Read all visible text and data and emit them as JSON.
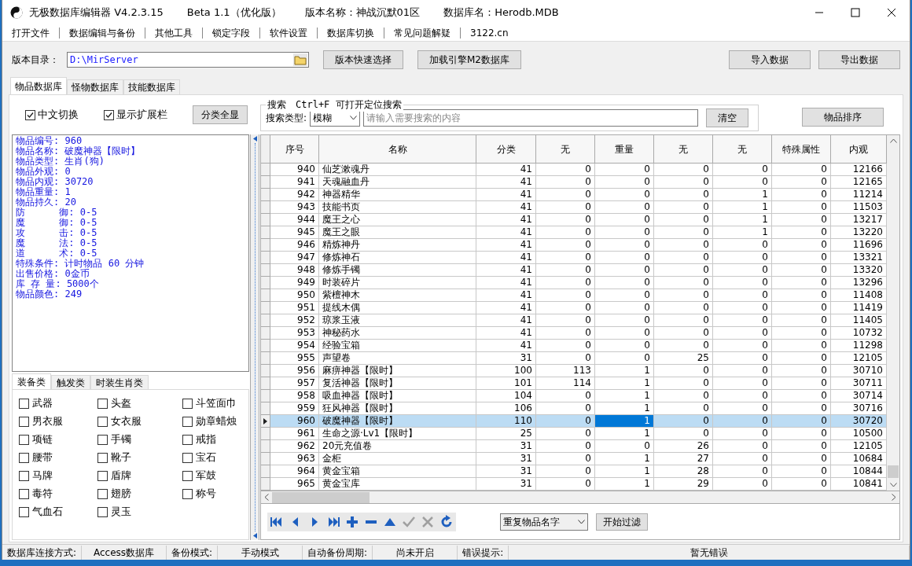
{
  "window": {
    "title_parts": [
      "无极数据库编辑器 V4.2.3.15",
      "Beta 1.1（优化版）",
      "版本名称：神战沉默01区",
      "数据库名：Herodb.MDB"
    ]
  },
  "menu": [
    "打开文件",
    "数据编辑与备份",
    "其他工具",
    "锁定字段",
    "软件设置",
    "数据库切换",
    "常见问题解疑",
    "3122.cn"
  ],
  "toolbar": {
    "dir_label": "版本目录：",
    "dir_value": "D:\\MirServer",
    "buttons": [
      "版本快速选择",
      "加载引擎M2数据库"
    ],
    "right_buttons": [
      "导入数据",
      "导出数据"
    ]
  },
  "tabs": [
    {
      "label": "物品数据库",
      "selected": true
    },
    {
      "label": "怪物数据库",
      "selected": false
    },
    {
      "label": "技能数据库",
      "selected": false
    }
  ],
  "options": [
    {
      "label": "中文切换",
      "checked": true
    },
    {
      "label": "显示扩展栏",
      "checked": true
    }
  ],
  "show_all_button": "分类全显",
  "search": {
    "title": "搜索　Ctrl+F 可打开定位搜索",
    "type_label": "搜索类型:",
    "type_value": "模糊",
    "placeholder": "请输入需要搜索的内容",
    "clear_button": "清空"
  },
  "sort_button": "物品排序",
  "info_lines": [
    "物品编号: 960",
    "物品名称: 破魔神器【限时】",
    "物品类型: 生肖(狗)",
    "物品外观: 0",
    "物品内观: 30720",
    "物品重量: 1",
    "物品持久: 20",
    "防      御: 0-5",
    "魔      御: 0-5",
    "攻      击: 0-5",
    "魔      法: 0-5",
    "道      术: 0-5",
    "特殊条件: 计时物品 60 分钟",
    "出售价格: 0金币",
    "库 存 量: 5000个",
    "物品颜色: 249"
  ],
  "sub_tabs": [
    {
      "label": "装备类",
      "selected": true
    },
    {
      "label": "触发类",
      "selected": false
    },
    {
      "label": "时装生肖类",
      "selected": false
    }
  ],
  "categories": [
    {
      "label": "武器",
      "checked": false
    },
    {
      "label": "头盔",
      "checked": false
    },
    {
      "label": "斗笠面巾",
      "checked": false
    },
    {
      "label": "男衣服",
      "checked": false
    },
    {
      "label": "女衣服",
      "checked": false
    },
    {
      "label": "勋章蜡烛",
      "checked": false
    },
    {
      "label": "项链",
      "checked": false
    },
    {
      "label": "手镯",
      "checked": false
    },
    {
      "label": "戒指",
      "checked": false
    },
    {
      "label": "腰带",
      "checked": false
    },
    {
      "label": "靴子",
      "checked": false
    },
    {
      "label": "宝石",
      "checked": false
    },
    {
      "label": "马牌",
      "checked": false
    },
    {
      "label": "盾牌",
      "checked": false
    },
    {
      "label": "军鼓",
      "checked": false
    },
    {
      "label": "毒符",
      "checked": false
    },
    {
      "label": "翅膀",
      "checked": false
    },
    {
      "label": "称号",
      "checked": false
    },
    {
      "label": "气血石",
      "checked": false
    },
    {
      "label": "灵玉",
      "checked": false
    }
  ],
  "table": {
    "columns": [
      {
        "label": "序号",
        "current": false
      },
      {
        "label": "名称",
        "current": false
      },
      {
        "label": "分类",
        "current": false
      },
      {
        "label": "无",
        "current": false
      },
      {
        "label": "重量",
        "current": true
      },
      {
        "label": "无",
        "current": false
      },
      {
        "label": "无",
        "current": false
      },
      {
        "label": "特殊属性",
        "current": false
      },
      {
        "label": "内观",
        "current": false
      }
    ],
    "rows": [
      {
        "cells": [
          "940",
          "仙芝漱魂丹",
          "41",
          "0",
          "0",
          "0",
          "0",
          "0",
          "12166"
        ],
        "selected": false
      },
      {
        "cells": [
          "941",
          "天魂融血丹",
          "41",
          "0",
          "0",
          "0",
          "0",
          "0",
          "12165"
        ],
        "selected": false
      },
      {
        "cells": [
          "942",
          "神器精华",
          "41",
          "0",
          "0",
          "0",
          "1",
          "0",
          "11214"
        ],
        "selected": false
      },
      {
        "cells": [
          "943",
          "技能书页",
          "41",
          "0",
          "0",
          "0",
          "1",
          "0",
          "11503"
        ],
        "selected": false
      },
      {
        "cells": [
          "944",
          "魔王之心",
          "41",
          "0",
          "0",
          "0",
          "1",
          "0",
          "13217"
        ],
        "selected": false
      },
      {
        "cells": [
          "945",
          "魔王之眼",
          "41",
          "0",
          "0",
          "0",
          "1",
          "0",
          "13220"
        ],
        "selected": false
      },
      {
        "cells": [
          "946",
          "精炼神丹",
          "41",
          "0",
          "0",
          "0",
          "0",
          "0",
          "11696"
        ],
        "selected": false
      },
      {
        "cells": [
          "947",
          "修炼神石",
          "41",
          "0",
          "0",
          "0",
          "0",
          "0",
          "13321"
        ],
        "selected": false
      },
      {
        "cells": [
          "948",
          "修炼手镯",
          "41",
          "0",
          "0",
          "0",
          "0",
          "0",
          "13320"
        ],
        "selected": false
      },
      {
        "cells": [
          "949",
          "时装碎片",
          "41",
          "0",
          "0",
          "0",
          "0",
          "0",
          "13296"
        ],
        "selected": false
      },
      {
        "cells": [
          "950",
          "紫檀神木",
          "41",
          "0",
          "0",
          "0",
          "0",
          "0",
          "11408"
        ],
        "selected": false
      },
      {
        "cells": [
          "951",
          "提线木偶",
          "41",
          "0",
          "0",
          "0",
          "0",
          "0",
          "11419"
        ],
        "selected": false
      },
      {
        "cells": [
          "952",
          "琼浆玉液",
          "41",
          "0",
          "0",
          "0",
          "0",
          "0",
          "11405"
        ],
        "selected": false
      },
      {
        "cells": [
          "953",
          "神秘药水",
          "41",
          "0",
          "0",
          "0",
          "0",
          "0",
          "10732"
        ],
        "selected": false
      },
      {
        "cells": [
          "954",
          "经验宝箱",
          "41",
          "0",
          "0",
          "0",
          "0",
          "0",
          "11298"
        ],
        "selected": false
      },
      {
        "cells": [
          "955",
          "声望卷",
          "31",
          "0",
          "0",
          "25",
          "0",
          "0",
          "12105"
        ],
        "selected": false
      },
      {
        "cells": [
          "956",
          "麻痹神器【限时】",
          "100",
          "113",
          "1",
          "0",
          "0",
          "0",
          "30710"
        ],
        "selected": false
      },
      {
        "cells": [
          "957",
          "复活神器【限时】",
          "101",
          "114",
          "1",
          "0",
          "0",
          "0",
          "30711"
        ],
        "selected": false
      },
      {
        "cells": [
          "958",
          "吸血神器【限时】",
          "104",
          "0",
          "1",
          "0",
          "0",
          "0",
          "30714"
        ],
        "selected": false
      },
      {
        "cells": [
          "959",
          "狂风神器【限时】",
          "106",
          "0",
          "1",
          "0",
          "0",
          "0",
          "30716"
        ],
        "selected": false
      },
      {
        "cells": [
          "960",
          "破魔神器【限时】",
          "110",
          "0",
          "1",
          "0",
          "0",
          "0",
          "30720"
        ],
        "selected": true
      },
      {
        "cells": [
          "961",
          "生命之源·Lv1【限时】",
          "25",
          "0",
          "1",
          "0",
          "0",
          "0",
          "10500"
        ],
        "selected": false
      },
      {
        "cells": [
          "962",
          "20元充值卷",
          "31",
          "0",
          "0",
          "26",
          "0",
          "0",
          "12105"
        ],
        "selected": false
      },
      {
        "cells": [
          "963",
          "金柜",
          "31",
          "0",
          "1",
          "27",
          "0",
          "0",
          "10684"
        ],
        "selected": false
      },
      {
        "cells": [
          "964",
          "黄金宝箱",
          "31",
          "0",
          "1",
          "28",
          "0",
          "0",
          "10844"
        ],
        "selected": false
      },
      {
        "cells": [
          "965",
          "黄金宝库",
          "31",
          "0",
          "1",
          "29",
          "0",
          "0",
          "10841"
        ],
        "selected": false
      }
    ]
  },
  "nav_buttons": [
    {
      "kind": "first",
      "disabled": false
    },
    {
      "kind": "prior",
      "disabled": false
    },
    {
      "kind": "next",
      "disabled": false
    },
    {
      "kind": "last",
      "disabled": false
    },
    {
      "kind": "insert",
      "disabled": false
    },
    {
      "kind": "delete",
      "disabled": false
    },
    {
      "kind": "edit",
      "disabled": false
    },
    {
      "kind": "post",
      "disabled": true
    },
    {
      "kind": "cancel",
      "disabled": true
    },
    {
      "kind": "refresh",
      "disabled": false
    }
  ],
  "filter": {
    "value": "重复物品名字",
    "button": "开始过滤"
  },
  "status_bar": [
    "数据库连接方式:",
    "Access数据库",
    "备份模式:",
    "手动模式",
    "自动备份周期:",
    "尚未开启",
    "错误提示:",
    "暂无错误"
  ]
}
